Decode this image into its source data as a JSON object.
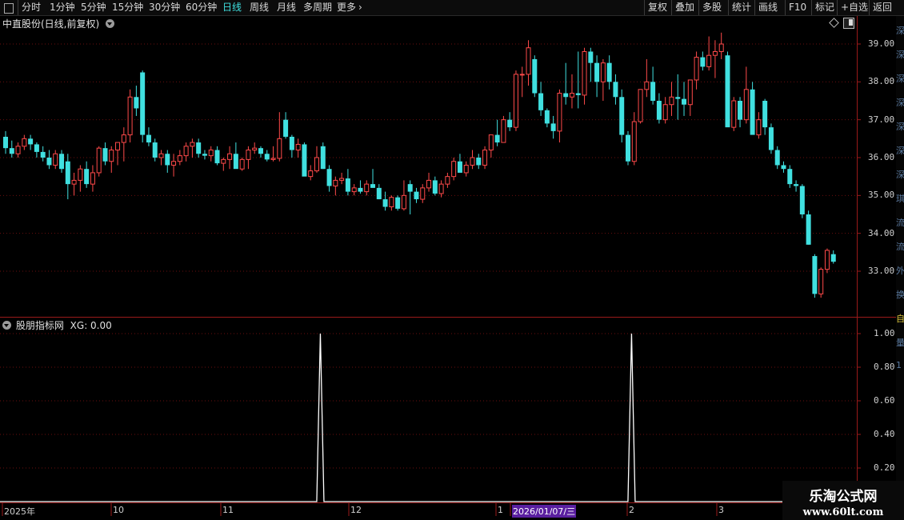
{
  "toolbar": {
    "left": [
      "分时",
      "1分钟",
      "5分钟",
      "15分钟",
      "30分钟",
      "60分钟",
      "日线",
      "周线",
      "月线",
      "多周期",
      "更多"
    ],
    "active": "日线",
    "more_chevron": "›",
    "right": [
      "复权",
      "叠加",
      "多股",
      "统计",
      "画线",
      "F10",
      "标记",
      "+自选",
      "返回"
    ]
  },
  "price_panel": {
    "title": "中直股份(日线,前复权)"
  },
  "indicator_panel": {
    "title": "股朋指标网",
    "xg_label": "XG: 0.00"
  },
  "date_axis": {
    "labels": [
      "2025年",
      "10",
      "11",
      "12",
      "1",
      "2026/01/07/三",
      "2",
      "3"
    ]
  },
  "watermark": {
    "line1": "乐淘公式网",
    "line2": "www.60lt.com"
  },
  "colors": {
    "up": "#ff4a4a",
    "down": "#40e0e0",
    "grid": "#6a0e0e",
    "axis": "#9a1a1a",
    "indicator_line": "#ffffff",
    "highlight_date_bg": "#5a1fa0"
  },
  "chart_data": [
    {
      "type": "candlestick",
      "ylim": [
        32.0,
        39.5
      ],
      "y_ticks": [
        "39.00",
        "38.00",
        "37.00",
        "36.00",
        "35.00",
        "34.00",
        "33.00"
      ],
      "ohlc": [
        [
          36.55,
          36.7,
          36.1,
          36.25
        ],
        [
          36.25,
          36.45,
          36.0,
          36.1
        ],
        [
          36.1,
          36.4,
          36.0,
          36.3
        ],
        [
          36.3,
          36.6,
          36.2,
          36.5
        ],
        [
          36.5,
          36.6,
          36.2,
          36.35
        ],
        [
          36.35,
          36.4,
          36.0,
          36.15
        ],
        [
          36.15,
          36.3,
          35.9,
          36.0
        ],
        [
          36.0,
          36.2,
          35.7,
          35.8
        ],
        [
          35.8,
          36.2,
          35.7,
          36.1
        ],
        [
          36.1,
          36.2,
          35.6,
          35.7
        ],
        [
          35.9,
          36.1,
          34.9,
          35.3
        ],
        [
          35.3,
          35.6,
          35.0,
          35.4
        ],
        [
          35.4,
          35.8,
          35.1,
          35.7
        ],
        [
          35.7,
          35.9,
          35.2,
          35.3
        ],
        [
          35.3,
          35.8,
          35.1,
          35.6
        ],
        [
          35.6,
          36.3,
          35.5,
          36.25
        ],
        [
          36.25,
          36.4,
          35.8,
          35.9
        ],
        [
          35.9,
          36.3,
          35.6,
          36.2
        ],
        [
          36.2,
          36.4,
          35.8,
          36.4
        ],
        [
          36.4,
          36.8,
          35.9,
          36.6
        ],
        [
          36.6,
          37.8,
          36.4,
          37.6
        ],
        [
          37.6,
          37.9,
          37.1,
          37.3
        ],
        [
          38.25,
          38.3,
          36.4,
          36.6
        ],
        [
          36.6,
          36.8,
          36.3,
          36.4
        ],
        [
          36.4,
          36.5,
          35.9,
          36.0
        ],
        [
          36.0,
          36.2,
          35.8,
          36.1
        ],
        [
          36.1,
          36.2,
          35.6,
          35.8
        ],
        [
          35.8,
          36.1,
          35.5,
          35.9
        ],
        [
          35.9,
          36.2,
          35.8,
          36.05
        ],
        [
          36.05,
          36.4,
          35.9,
          36.3
        ],
        [
          36.3,
          36.5,
          36.0,
          36.4
        ],
        [
          36.4,
          36.5,
          36.0,
          36.1
        ],
        [
          36.1,
          36.2,
          35.95,
          36.05
        ],
        [
          36.05,
          36.3,
          35.9,
          36.2
        ],
        [
          36.2,
          36.3,
          35.8,
          35.85
        ],
        [
          35.85,
          36.0,
          35.65,
          35.95
        ],
        [
          35.95,
          36.3,
          35.7,
          36.1
        ],
        [
          36.1,
          36.4,
          35.8,
          35.7
        ],
        [
          35.7,
          36.0,
          35.65,
          35.95
        ],
        [
          35.95,
          36.3,
          35.7,
          36.2
        ],
        [
          36.2,
          36.4,
          36.1,
          36.25
        ],
        [
          36.25,
          36.3,
          36.0,
          36.1
        ],
        [
          36.1,
          36.2,
          35.9,
          35.95
        ],
        [
          35.95,
          36.3,
          35.9,
          35.98
        ],
        [
          35.98,
          37.2,
          35.9,
          36.5
        ],
        [
          37.0,
          37.2,
          36.5,
          36.55
        ],
        [
          36.55,
          36.6,
          36.0,
          36.2
        ],
        [
          36.2,
          36.5,
          36.0,
          36.35
        ],
        [
          36.35,
          36.4,
          35.7,
          35.5
        ],
        [
          35.5,
          35.8,
          35.4,
          35.65
        ],
        [
          35.65,
          36.3,
          35.6,
          36.0
        ],
        [
          36.3,
          36.4,
          35.7,
          35.7
        ],
        [
          35.7,
          35.8,
          35.1,
          35.25
        ],
        [
          35.25,
          35.5,
          35.0,
          35.4
        ],
        [
          35.4,
          35.6,
          35.3,
          35.45
        ],
        [
          35.45,
          35.7,
          35.0,
          35.1
        ],
        [
          35.1,
          35.3,
          35.0,
          35.2
        ],
        [
          35.2,
          35.4,
          35.05,
          35.1
        ],
        [
          35.1,
          35.4,
          35.0,
          35.3
        ],
        [
          35.3,
          35.7,
          35.2,
          35.2
        ],
        [
          35.2,
          35.3,
          34.9,
          34.9
        ],
        [
          34.9,
          35.1,
          34.6,
          34.7
        ],
        [
          34.7,
          35.0,
          34.6,
          34.95
        ],
        [
          34.95,
          35.0,
          34.6,
          34.65
        ],
        [
          34.65,
          35.4,
          34.6,
          35.0
        ],
        [
          35.3,
          35.4,
          34.5,
          35.1
        ],
        [
          35.1,
          35.2,
          34.8,
          34.9
        ],
        [
          34.9,
          35.3,
          34.8,
          35.2
        ],
        [
          35.2,
          35.6,
          35.1,
          35.4
        ],
        [
          35.4,
          35.5,
          35.0,
          35.05
        ],
        [
          35.05,
          35.4,
          34.95,
          35.3
        ],
        [
          35.3,
          35.6,
          35.2,
          35.5
        ],
        [
          35.5,
          36.0,
          35.4,
          35.9
        ],
        [
          35.9,
          36.1,
          35.6,
          35.6
        ],
        [
          35.6,
          35.9,
          35.5,
          35.8
        ],
        [
          35.8,
          36.2,
          35.7,
          36.0
        ],
        [
          36.0,
          36.1,
          35.7,
          35.8
        ],
        [
          35.8,
          36.3,
          35.7,
          36.2
        ],
        [
          36.2,
          36.5,
          36.0,
          36.6
        ],
        [
          36.6,
          37.0,
          36.3,
          36.4
        ],
        [
          36.4,
          37.1,
          36.4,
          37.0
        ],
        [
          37.0,
          37.2,
          36.7,
          36.8
        ],
        [
          36.8,
          38.3,
          36.7,
          38.2
        ],
        [
          38.2,
          38.4,
          37.6,
          38.2
        ],
        [
          38.2,
          39.1,
          37.9,
          38.9
        ],
        [
          38.6,
          38.7,
          37.6,
          37.7
        ],
        [
          37.7,
          38.0,
          37.1,
          37.25
        ],
        [
          37.25,
          37.3,
          36.8,
          36.9
        ],
        [
          36.9,
          37.1,
          36.5,
          36.7
        ],
        [
          36.7,
          37.8,
          36.4,
          37.7
        ],
        [
          37.7,
          38.5,
          37.4,
          37.6
        ],
        [
          37.6,
          38.2,
          37.3,
          37.7
        ],
        [
          37.7,
          38.8,
          37.3,
          37.65
        ],
        [
          37.65,
          38.9,
          37.4,
          38.8
        ],
        [
          38.8,
          38.9,
          38.0,
          38.5
        ],
        [
          38.5,
          38.7,
          37.6,
          38.0
        ],
        [
          38.0,
          38.6,
          37.5,
          38.5
        ],
        [
          38.5,
          38.7,
          37.8,
          38.0
        ],
        [
          38.0,
          38.2,
          37.4,
          37.6
        ],
        [
          37.6,
          37.8,
          36.4,
          36.6
        ],
        [
          36.6,
          36.7,
          35.8,
          35.9
        ],
        [
          35.9,
          37.2,
          35.8,
          36.95
        ],
        [
          36.95,
          37.8,
          36.9,
          37.8
        ],
        [
          37.8,
          38.6,
          37.6,
          38.0
        ],
        [
          38.0,
          38.4,
          37.4,
          37.5
        ],
        [
          37.5,
          37.7,
          36.9,
          37.0
        ],
        [
          37.0,
          37.6,
          36.9,
          37.4
        ],
        [
          37.4,
          38.0,
          37.1,
          37.6
        ],
        [
          37.6,
          38.2,
          37.0,
          37.55
        ],
        [
          37.55,
          38.0,
          37.1,
          37.4
        ],
        [
          37.4,
          38.0,
          37.1,
          38.05
        ],
        [
          38.05,
          38.8,
          37.8,
          38.65
        ],
        [
          38.65,
          38.8,
          38.3,
          38.4
        ],
        [
          38.4,
          39.2,
          38.3,
          38.7
        ],
        [
          38.7,
          39.1,
          38.1,
          38.8
        ],
        [
          38.8,
          39.3,
          38.6,
          39.0
        ],
        [
          38.7,
          38.8,
          36.9,
          36.8
        ],
        [
          36.8,
          37.6,
          36.7,
          37.5
        ],
        [
          37.5,
          37.6,
          36.8,
          37.0
        ],
        [
          37.0,
          38.4,
          36.9,
          37.8
        ],
        [
          37.8,
          38.0,
          36.7,
          36.6
        ],
        [
          36.6,
          37.2,
          36.5,
          37.0
        ],
        [
          37.5,
          37.55,
          36.6,
          36.8
        ],
        [
          36.8,
          36.9,
          36.1,
          36.2
        ],
        [
          36.2,
          36.3,
          35.7,
          35.8
        ],
        [
          35.8,
          35.9,
          35.6,
          35.7
        ],
        [
          35.7,
          35.8,
          35.2,
          35.3
        ],
        [
          35.3,
          35.4,
          35.1,
          35.25
        ],
        [
          35.25,
          35.3,
          34.4,
          34.5
        ],
        [
          34.5,
          34.6,
          33.7,
          33.7
        ],
        [
          33.4,
          33.45,
          32.3,
          32.4
        ],
        [
          32.4,
          33.1,
          32.3,
          33.05
        ],
        [
          33.05,
          33.6,
          32.95,
          33.55
        ],
        [
          33.45,
          33.55,
          33.2,
          33.25
        ]
      ]
    },
    {
      "type": "line",
      "name": "XG",
      "ylim": [
        0,
        1.0
      ],
      "y_ticks": [
        "1.00",
        "0.80",
        "0.60",
        "0.40",
        "0.20"
      ],
      "spike_indices": [
        48,
        98
      ],
      "last_value": 0.0
    }
  ]
}
